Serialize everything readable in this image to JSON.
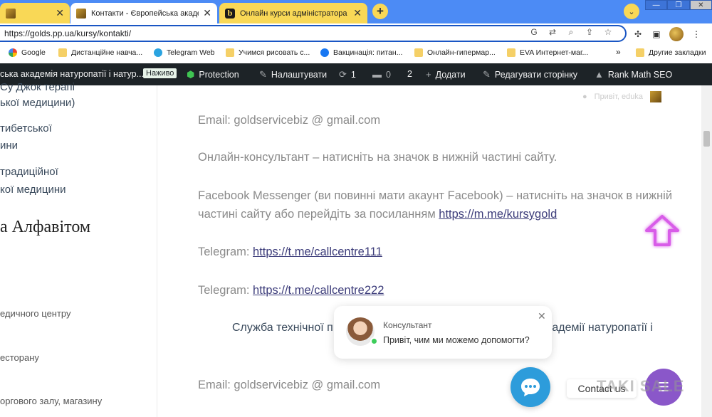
{
  "browser": {
    "tabs": [
      {
        "label": "",
        "favicon": "gold-icon"
      },
      {
        "label": "Контакти - Європейська академ",
        "favicon": "gold-icon",
        "active": true
      },
      {
        "label": "Онлайн курси адміністратора а",
        "favicon": "b-icon",
        "favicon_letter": "b"
      }
    ],
    "url": "https://golds.pp.ua/kursy/kontakti/",
    "bookmarks": [
      {
        "label": "Google",
        "icon": "google-icon"
      },
      {
        "label": "Дистанційне навча...",
        "icon": "folder-icon"
      },
      {
        "label": "Telegram Web",
        "icon": "telegram-icon"
      },
      {
        "label": "Учимся рисовать с...",
        "icon": "folder-icon"
      },
      {
        "label": "Вакцинація: питан...",
        "icon": "facebook-icon"
      },
      {
        "label": "Онлайн-гипермар...",
        "icon": "folder-icon"
      },
      {
        "label": "EVA Интернет-маг...",
        "icon": "folder-icon"
      },
      {
        "label": "Другие закладки",
        "icon": "folder-icon"
      }
    ],
    "more_glyph": "»"
  },
  "adminbar": {
    "site_name": "ська академія натуропатії і натур...",
    "live_badge": "Наживо",
    "protection": "Protection",
    "customize": "Налаштувати",
    "updates_count": "1",
    "comments_count": "0",
    "extra_count": "2",
    "add_new": "Додати",
    "edit_page": "Редагувати сторінку",
    "rank_math": "Rank Math SEO"
  },
  "sidebar": {
    "links": [
      "Су Джок терапі",
      "ької медицини)",
      "тибетської",
      "ини",
      "традиційної",
      "кої медицини"
    ],
    "heading": "а Алфавітом",
    "small_links": [
      "едичного центру",
      "есторану",
      "оргового залу, магазину"
    ]
  },
  "content": {
    "email_label": "Email: goldservicebiz @ gmail.com",
    "consultant_text": "Онлайн-консультант – натисніть на значок в нижній частині сайту.",
    "fb_text_1": "Facebook Messenger (ви повинні мати акаунт Facebook) – натисніть на значок в нижній",
    "fb_text_2": "частині сайту або перейдіть за посиланням ",
    "fb_link": "https://m.me/kursygold",
    "telegram_label": "Telegram: ",
    "telegram_link_1": "https://t.me/callcentre111",
    "telegram_link_2": "https://t.me/callcentre222",
    "service_left": "Служба технічної п",
    "service_right": "кадемії натуропатії і",
    "email_label_2": "Email: goldservicebiz @ gmail.com",
    "header_greeting": "Привіт, eduka"
  },
  "chat": {
    "agent_name": "Консультант",
    "message": "Привіт, чим ми можемо допомогти?",
    "contact_us": "Contact us"
  },
  "watermark": "TAKI SALE",
  "colors": {
    "tabstrip": "#4c8bf5",
    "tab_inactive": "#f9d856",
    "adminbar": "#1d2327",
    "link": "#3c3c7a",
    "chat_button": "#2d9cdb",
    "purple_button": "#8a57c9",
    "online_dot": "#3ccd5a"
  }
}
